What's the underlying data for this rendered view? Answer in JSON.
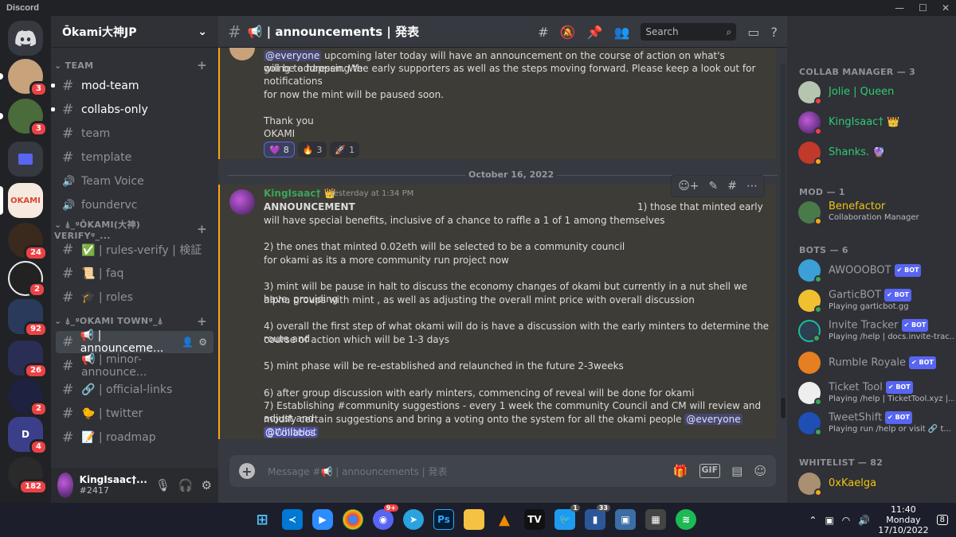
{
  "app": {
    "name": "Discord"
  },
  "guild": {
    "name": "Ōkami大神JP"
  },
  "servers": [
    {
      "badge": "3",
      "color": "#c7a27a"
    },
    {
      "badge": "3",
      "color": "#4a6b3a"
    },
    {
      "badge": "",
      "color": "#5865f2"
    },
    {
      "badge": "",
      "color": "#f6e9e0"
    },
    {
      "badge": "24",
      "color": "#3a2a1e"
    },
    {
      "badge": "2",
      "color": "#222222"
    },
    {
      "badge": "92",
      "color": "#2a3a5a"
    },
    {
      "badge": "26",
      "color": "#2a2e55"
    },
    {
      "badge": "2",
      "color": "#1e2140"
    },
    {
      "badge": "4",
      "color": "#3b3f8a"
    },
    {
      "badge": "182",
      "color": "#2a2a2a"
    }
  ],
  "categories": {
    "team": "TEAM",
    "verify": "⍋_ᵍŌKAMI(大神) VERIFYᵍ_...",
    "town": "⍋_ᵍOKAMI TOWNᵍ_⍋"
  },
  "channels": {
    "mod_team": "mod-team",
    "collabs_only": "collabs-only",
    "team": "team",
    "template": "template",
    "team_voice": "Team Voice",
    "foundervc": "foundervc",
    "rules_verify": "✅ | rules-verify | 検証",
    "faq": "📜 | faq",
    "roles": "🎓 | roles",
    "announcements": "📢 | announceme...",
    "minor_announce": "📢 | minor-announce...",
    "official_links": "🔗 | official-links",
    "twitter": "🐤 | twitter",
    "roadmap": "📝 | roadmap"
  },
  "user": {
    "name": "KingIsaac†...",
    "tag": "#2417"
  },
  "header": {
    "channel": "📢 | announcements | 発表",
    "search_placeholder": "Search"
  },
  "message1": {
    "mention": "@everyone",
    "line1": " upcoming later today will have an announcement on the course of action on what's going to happen. We",
    "line2": "will be addressing the early supporters as well as the steps moving forward. Please keep a look out for notifications",
    "line3": "for now the mint will be paused soon.",
    "line4": "Thank you",
    "line5": "OKAMI",
    "reactions": [
      {
        "emoji": "💜",
        "count": "8"
      },
      {
        "emoji": "🔥",
        "count": "3"
      },
      {
        "emoji": "🚀",
        "count": "1"
      }
    ]
  },
  "date_divider": "October 16, 2022",
  "message2": {
    "author": "KingIsaac† 👑",
    "time": "Yesterday at 1:34 PM",
    "title": "ANNOUNCEMENT",
    "p1_right": "1) those that minted early",
    "p1": "will have special benefits, inclusive of a chance to raffle a 1 of 1 among themselves",
    "p2a": "2) the ones that minted 0.02eth will be selected to be a community council",
    "p2b": "for okami as its a more community run project now",
    "p3a": "3) mint will be pause in halt to discuss the economy changes of okami but currently in a nut shell we have, providing",
    "p3b": "alpha groups with mint , as well as adjusting the overall mint price with overall discussion",
    "p4a": "4) overall the first step of what okami will do is have a discussion with the early minters to determine the route and",
    "p4b": "course of action which will be 1-3 days",
    "p5": "5) mint phase will be re-established and relaunched in the future 2-3weeks",
    "p6": "6) after group discussion with early minters, commencing of reveal will be done for okami",
    "p7a": "7) Establishing #community suggestions - every 1 week the community Council and CM will review and adjust and",
    "p7b": "modify certain suggestions and bring a voting onto the system for all the okami people ",
    "m_everyone": "@everyone",
    "m_whitelist": "@Whitelist",
    "m_collabos": "@Collabos"
  },
  "composer": {
    "placeholder": "Message #📢 | announcements | 発表"
  },
  "members": {
    "collab_header": "COLLAB MANAGER — 3",
    "mod_header": "MOD — 1",
    "bots_header": "BOTS — 6",
    "whitelist_header": "WHITELIST — 82",
    "bot_label": "✔ BOT",
    "list": {
      "jolie": {
        "name": "Jolie | Queen",
        "sub": "",
        "color": "#2ecc71"
      },
      "king": {
        "name": "KingIsaac† 👑",
        "sub": "",
        "color": "#2ecc71"
      },
      "shanks": {
        "name": "Shanks. 🔮",
        "sub": "",
        "color": "#2ecc71"
      },
      "benefactor": {
        "name": "Benefactor",
        "sub": "Collaboration Manager",
        "color": "#f1c40f"
      },
      "awooo": {
        "name": "AWOOOBOT",
        "sub": "",
        "color": "#9b9ea3"
      },
      "gartic": {
        "name": "GarticBOT",
        "sub": "Playing garticbot.gg",
        "color": "#9b9ea3"
      },
      "invite": {
        "name": "Invite Tracker",
        "sub": "Playing /help | docs.invite-trac...",
        "color": "#9b9ea3"
      },
      "rumble": {
        "name": "Rumble Royale",
        "sub": "",
        "color": "#9b9ea3"
      },
      "ticket": {
        "name": "Ticket Tool",
        "sub": "Playing /help | TicketTool.xyz |...",
        "color": "#9b9ea3"
      },
      "tweet": {
        "name": "TweetShift",
        "sub": "Playing run /help or visit 🔗 t...",
        "color": "#9b9ea3"
      },
      "kaelga": {
        "name": "0xKaelga",
        "sub": "",
        "color": "#f1c40f"
      }
    }
  },
  "taskbar": {
    "time": "11:40",
    "day": "Monday",
    "date": "17/10/2022",
    "discord_badge": "9+",
    "twitter_badge": "1",
    "app_badge": "33",
    "notif": "8"
  }
}
